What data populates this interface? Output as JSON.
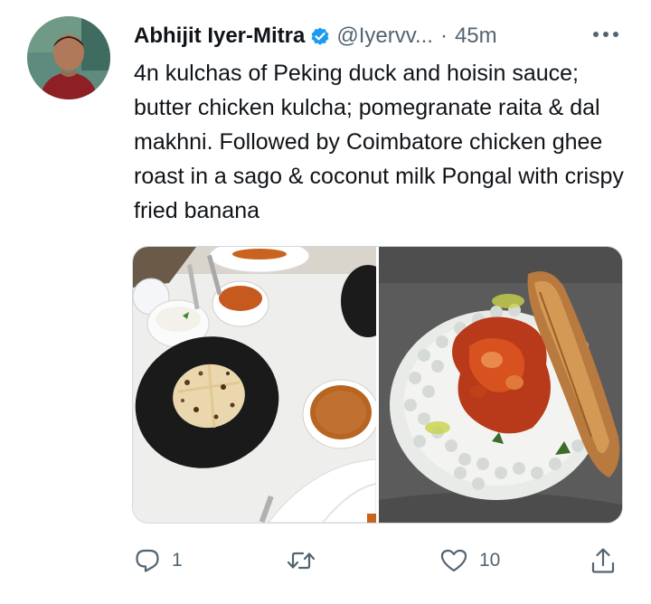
{
  "tweet": {
    "author_name": "Abhijit Iyer-Mitra",
    "handle": "@Iyervv...",
    "separator": "·",
    "time": "45m",
    "text": "4n kulchas of Peking duck and hoisin sauce; butter chicken kulcha; pomegranate raita & dal makhni. Followed by Coimbatore chicken ghee roast in a sago & coconut milk Pongal with crispy fried banana"
  },
  "icons": {
    "verified": "verified-badge-icon",
    "more": "more-options-icon",
    "reply": "reply-icon",
    "retweet": "retweet-icon",
    "like": "like-icon",
    "share": "share-icon"
  },
  "actions": {
    "reply_count": "1",
    "retweet_count": "",
    "like_count": "10"
  },
  "colors": {
    "text": "#0f1419",
    "secondary": "#536471",
    "verified": "#1d9bf0",
    "border": "#cfd9de"
  }
}
